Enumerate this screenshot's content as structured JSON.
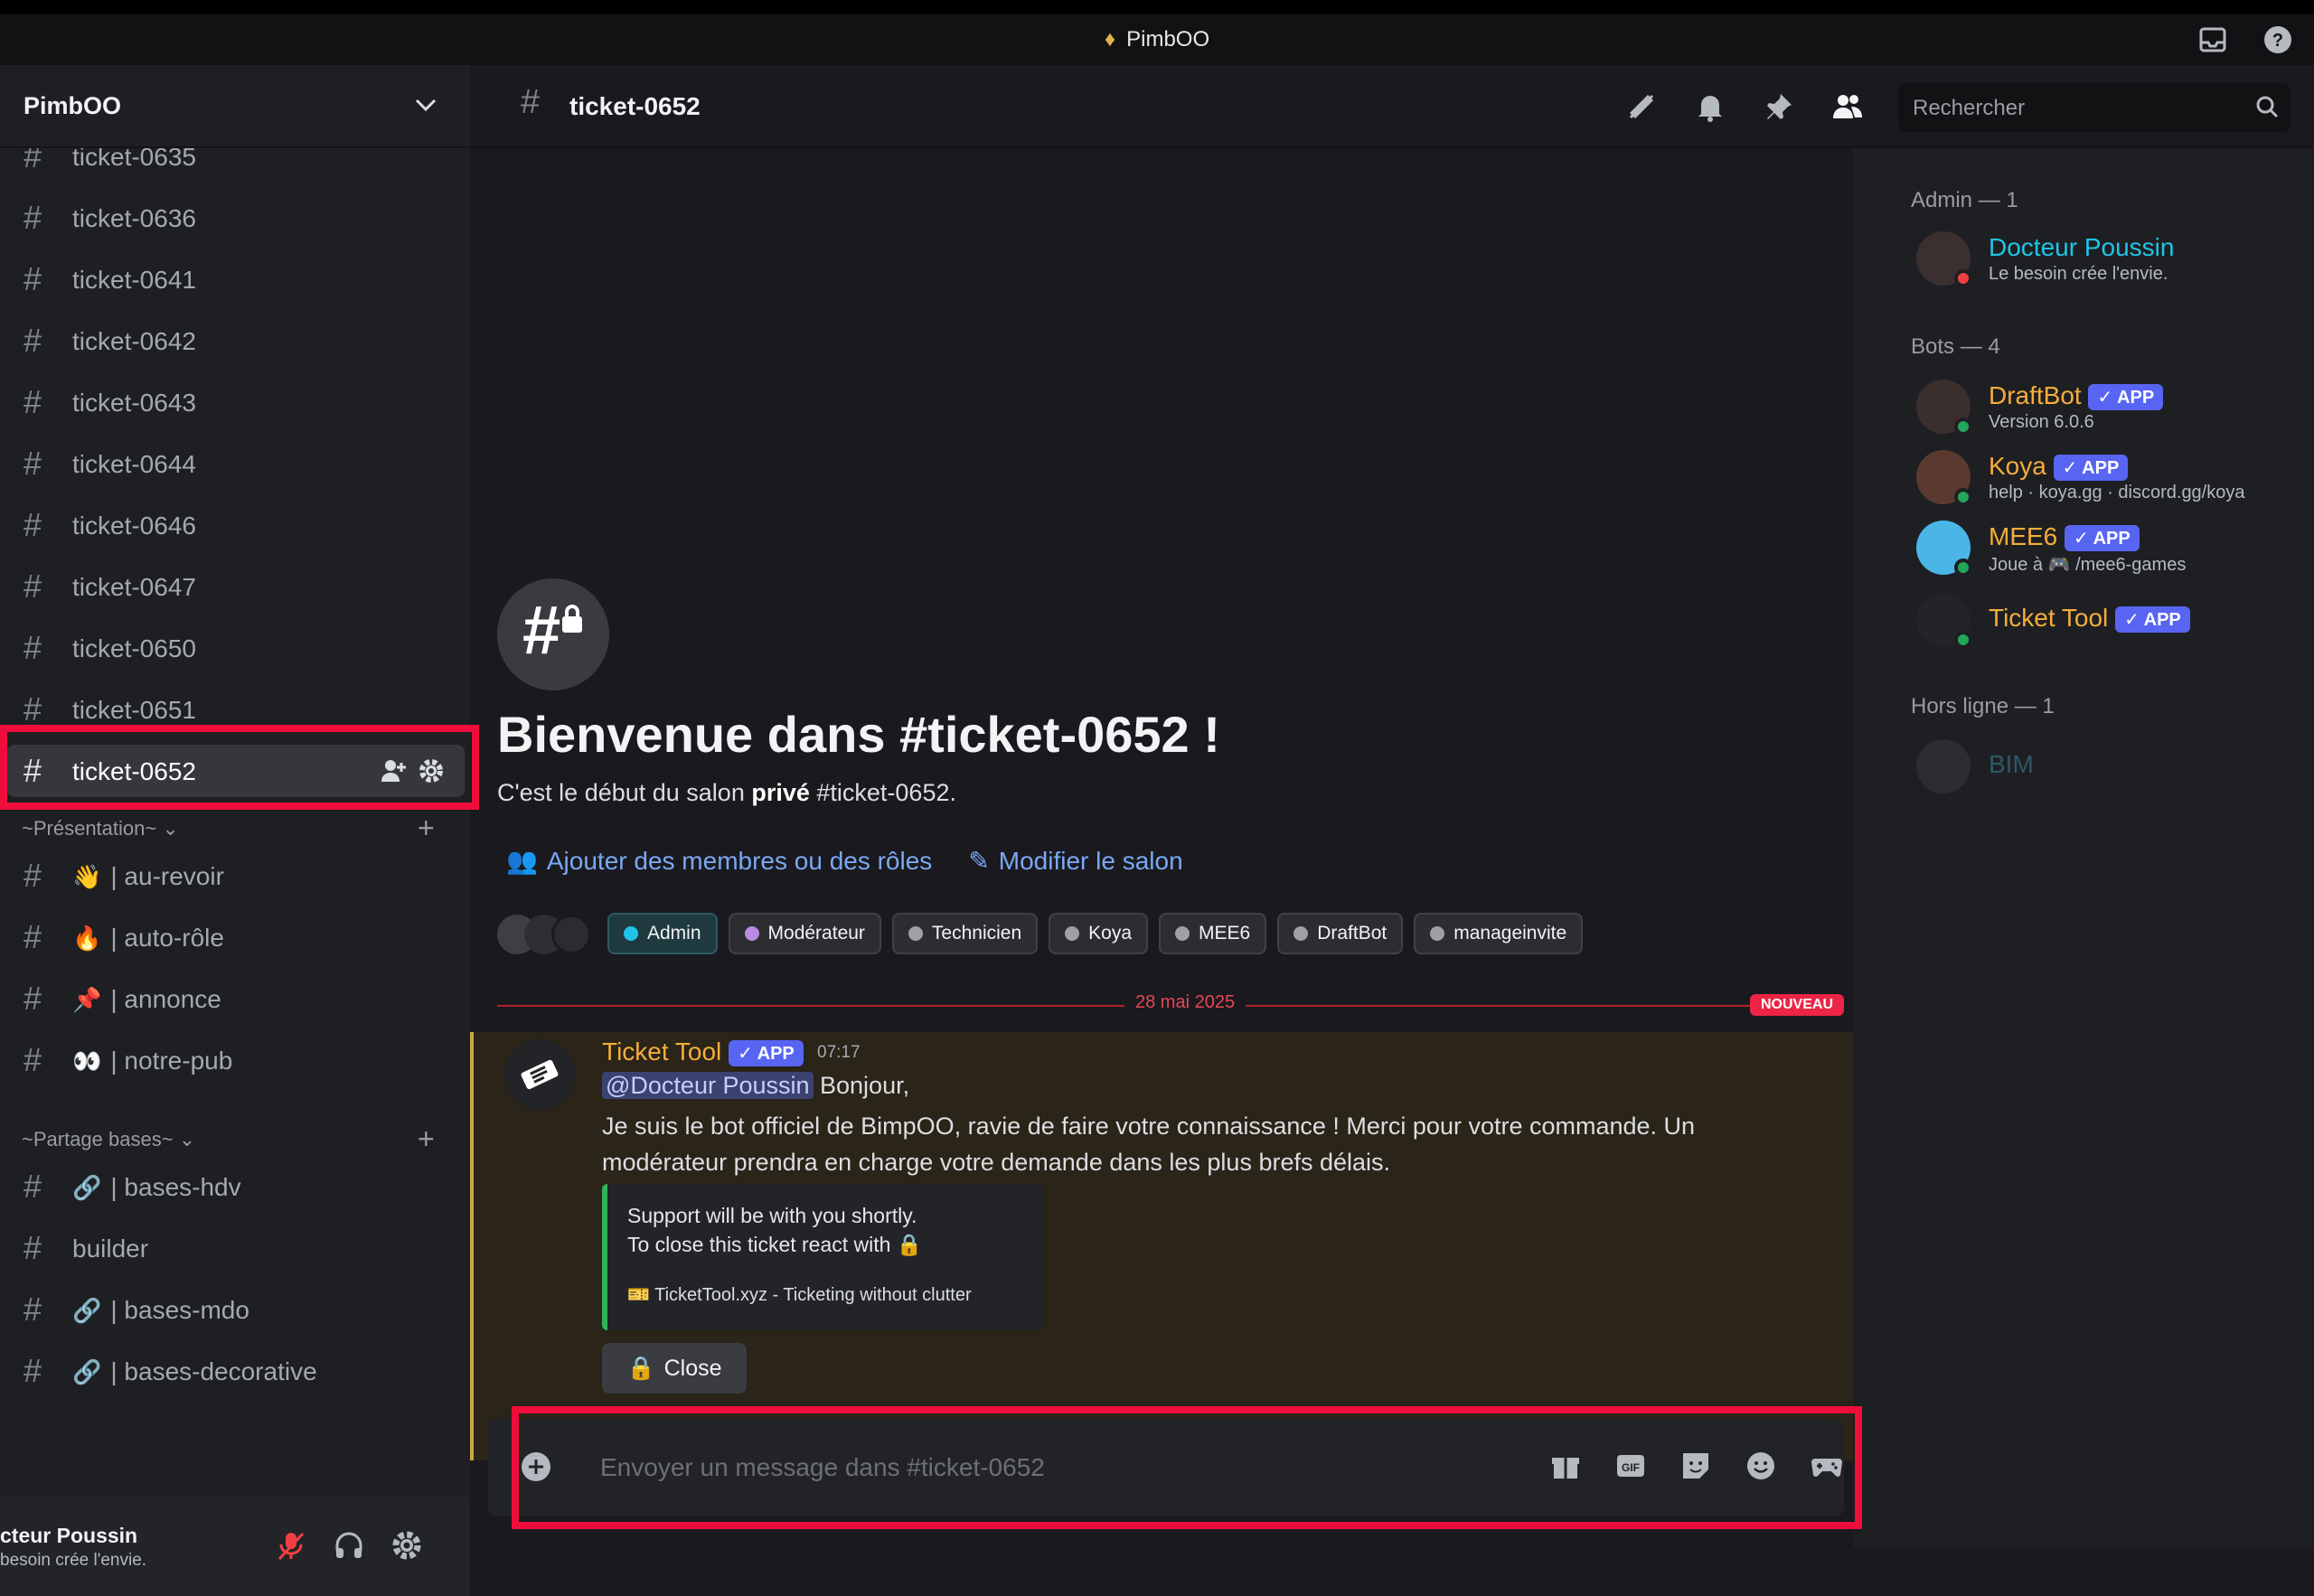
{
  "window": {
    "title": "PimbOO"
  },
  "server": {
    "name": "PimbOO"
  },
  "channels": [
    {
      "label": "ticket-0635"
    },
    {
      "label": "ticket-0636"
    },
    {
      "label": "ticket-0641"
    },
    {
      "label": "ticket-0642"
    },
    {
      "label": "ticket-0643"
    },
    {
      "label": "ticket-0644"
    },
    {
      "label": "ticket-0646"
    },
    {
      "label": "ticket-0647"
    },
    {
      "label": "ticket-0650"
    },
    {
      "label": "ticket-0651"
    },
    {
      "label": "ticket-0652"
    }
  ],
  "categories": [
    {
      "name": "~Présentation~",
      "channels": [
        {
          "emoji": "👋",
          "label": "| au-revoir"
        },
        {
          "emoji": "🔥",
          "label": "| auto-rôle"
        },
        {
          "emoji": "📌",
          "label": "| annonce"
        },
        {
          "emoji": "👀",
          "label": "| notre-pub"
        }
      ]
    },
    {
      "name": "~Partage bases~",
      "channels": [
        {
          "emoji": "🔗",
          "label": "| bases-hdv"
        },
        {
          "emoji": "",
          "label": "builder"
        },
        {
          "emoji": "🔗",
          "label": "| bases-mdo"
        },
        {
          "emoji": "🔗",
          "label": "| bases-decorative"
        }
      ]
    }
  ],
  "user": {
    "name": "cteur Poussin",
    "status": "besoin crée l'envie."
  },
  "header": {
    "channel": "ticket-0652",
    "search_placeholder": "Rechercher"
  },
  "welcome": {
    "title": "Bienvenue dans #ticket-0652 !",
    "sub_prefix": "C'est le début du salon ",
    "sub_bold": "privé",
    "sub_suffix": " #ticket-0652.",
    "add_members": "Ajouter des membres ou des rôles",
    "edit_channel": "Modifier le salon"
  },
  "roles": [
    {
      "name": "Admin",
      "color": "#1fc5e8"
    },
    {
      "name": "Modérateur",
      "color": "#b88ce0"
    },
    {
      "name": "Technicien",
      "color": "#9ea0a6"
    },
    {
      "name": "Koya",
      "color": "#9ea0a6"
    },
    {
      "name": "MEE6",
      "color": "#9ea0a6"
    },
    {
      "name": "DraftBot",
      "color": "#9ea0a6"
    },
    {
      "name": "manageinvite",
      "color": "#9ea0a6"
    }
  ],
  "divider": {
    "date": "28 mai 2025",
    "new_label": "NOUVEAU"
  },
  "message": {
    "author": "Ticket Tool",
    "badge": "APP",
    "time": "07:17",
    "mention": "@Docteur Poussin",
    "greeting": " Bonjour,",
    "body": "Je suis le bot officiel de BimpOO, ravie de faire votre connaissance ! Merci pour votre commande. Un modérateur prendra en charge votre demande dans les plus brefs délais.",
    "embed_line1": "Support will be with you shortly.",
    "embed_line2": "To close this ticket react with",
    "embed_footer": "TicketTool.xyz - Ticketing without clutter",
    "close_label": "Close"
  },
  "composer": {
    "placeholder": "Envoyer un message dans #ticket-0652"
  },
  "members": {
    "admin_header": "Admin — 1",
    "bots_header": "Bots — 4",
    "offline_header": "Hors ligne — 1",
    "admin": [
      {
        "name": "Docteur Poussin",
        "sub": "Le besoin crée l'envie.",
        "color": "#1fc5e8"
      }
    ],
    "bots": [
      {
        "name": "DraftBot",
        "sub": "Version 6.0.6",
        "color": "#f5ad3b"
      },
      {
        "name": "Koya",
        "sub": "help · koya.gg · discord.gg/koya",
        "color": "#f5ad3b"
      },
      {
        "name": "MEE6",
        "sub": "Joue à 🎮 /mee6-games",
        "color": "#f5ad3b"
      },
      {
        "name": "Ticket Tool",
        "sub": "",
        "color": "#f5ad3b"
      }
    ],
    "offline": [
      {
        "name": "BIM",
        "color": "#3f6c7c"
      }
    ]
  }
}
